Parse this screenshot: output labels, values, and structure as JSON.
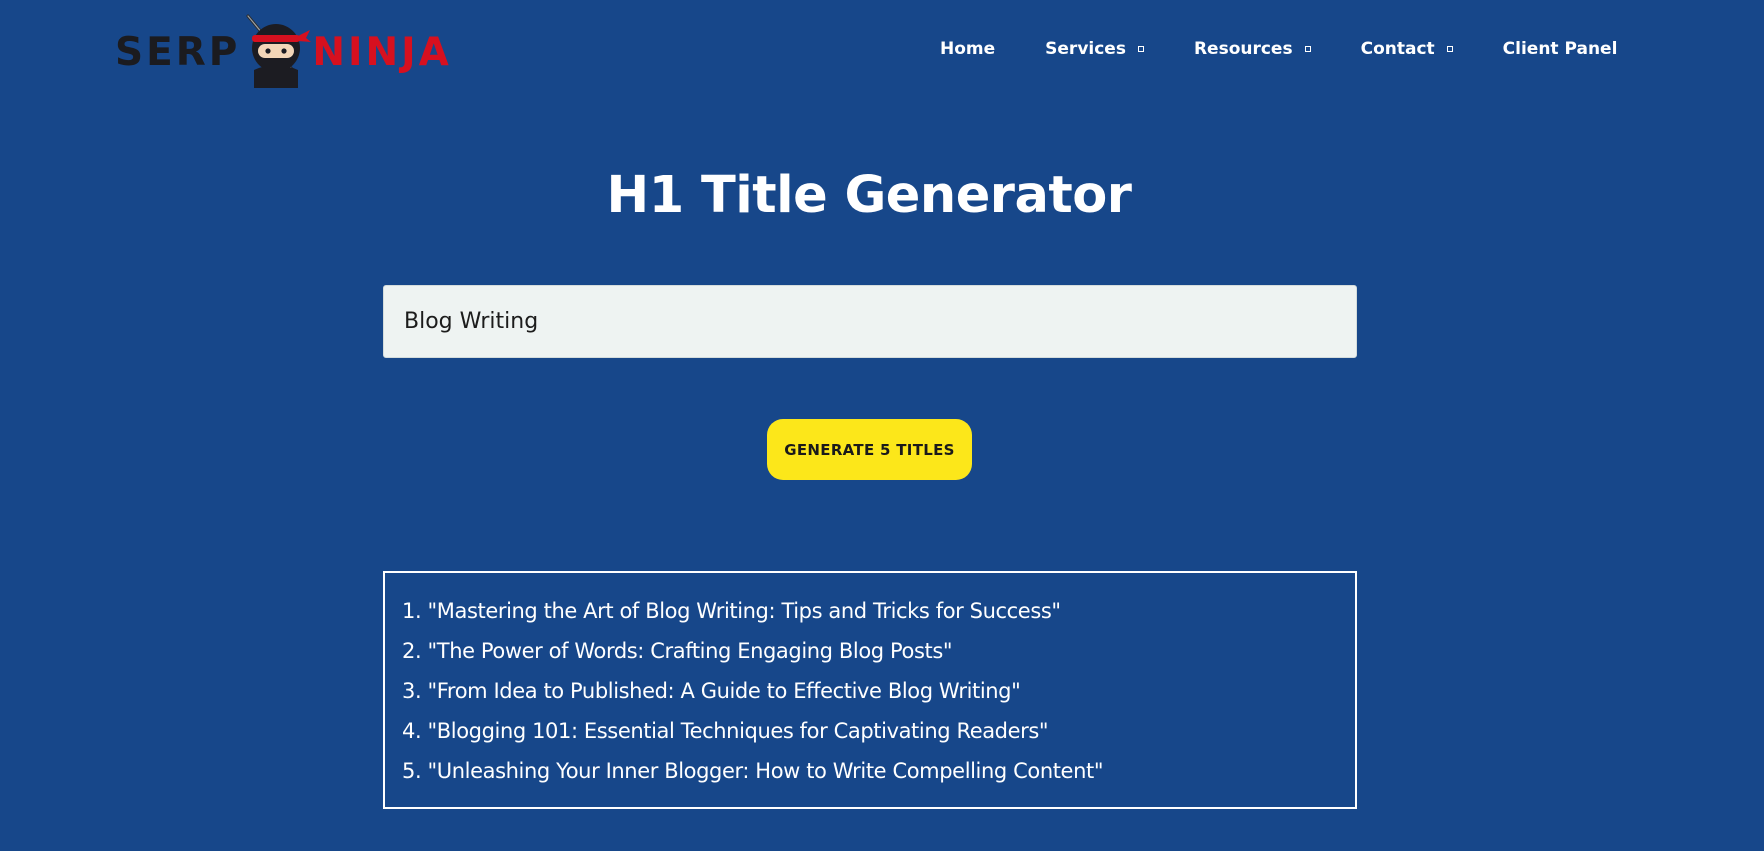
{
  "brand": {
    "name_left": "SERP",
    "name_right": "NINJA"
  },
  "nav": {
    "items": [
      {
        "label": "Home",
        "has_dropdown": false
      },
      {
        "label": "Services",
        "has_dropdown": true
      },
      {
        "label": "Resources",
        "has_dropdown": true
      },
      {
        "label": "Contact",
        "has_dropdown": true
      },
      {
        "label": "Client Panel",
        "has_dropdown": false
      }
    ]
  },
  "main": {
    "title": "H1 Title Generator",
    "keyword_input": {
      "value": "Blog Writing"
    },
    "generate_button": "GENERATE 5 TITLES",
    "results": [
      "1. \"Mastering the Art of Blog Writing: Tips and Tricks for Success\"",
      "2. \"The Power of Words: Crafting Engaging Blog Posts\"",
      "3. \"From Idea to Published: A Guide to Effective Blog Writing\"",
      "4. \"Blogging 101: Essential Techniques for Captivating Readers\"",
      "5. \"Unleashing Your Inner Blogger: How to Write Compelling Content\""
    ]
  },
  "colors": {
    "background": "#17478a",
    "button": "#fce71a",
    "input_background": "#eef3f2",
    "brand_red": "#d6101f",
    "brand_dark": "#1b1b1f"
  },
  "icons": {
    "logo": "ninja-mascot-icon",
    "dropdown": "dropdown-caret-icon"
  }
}
